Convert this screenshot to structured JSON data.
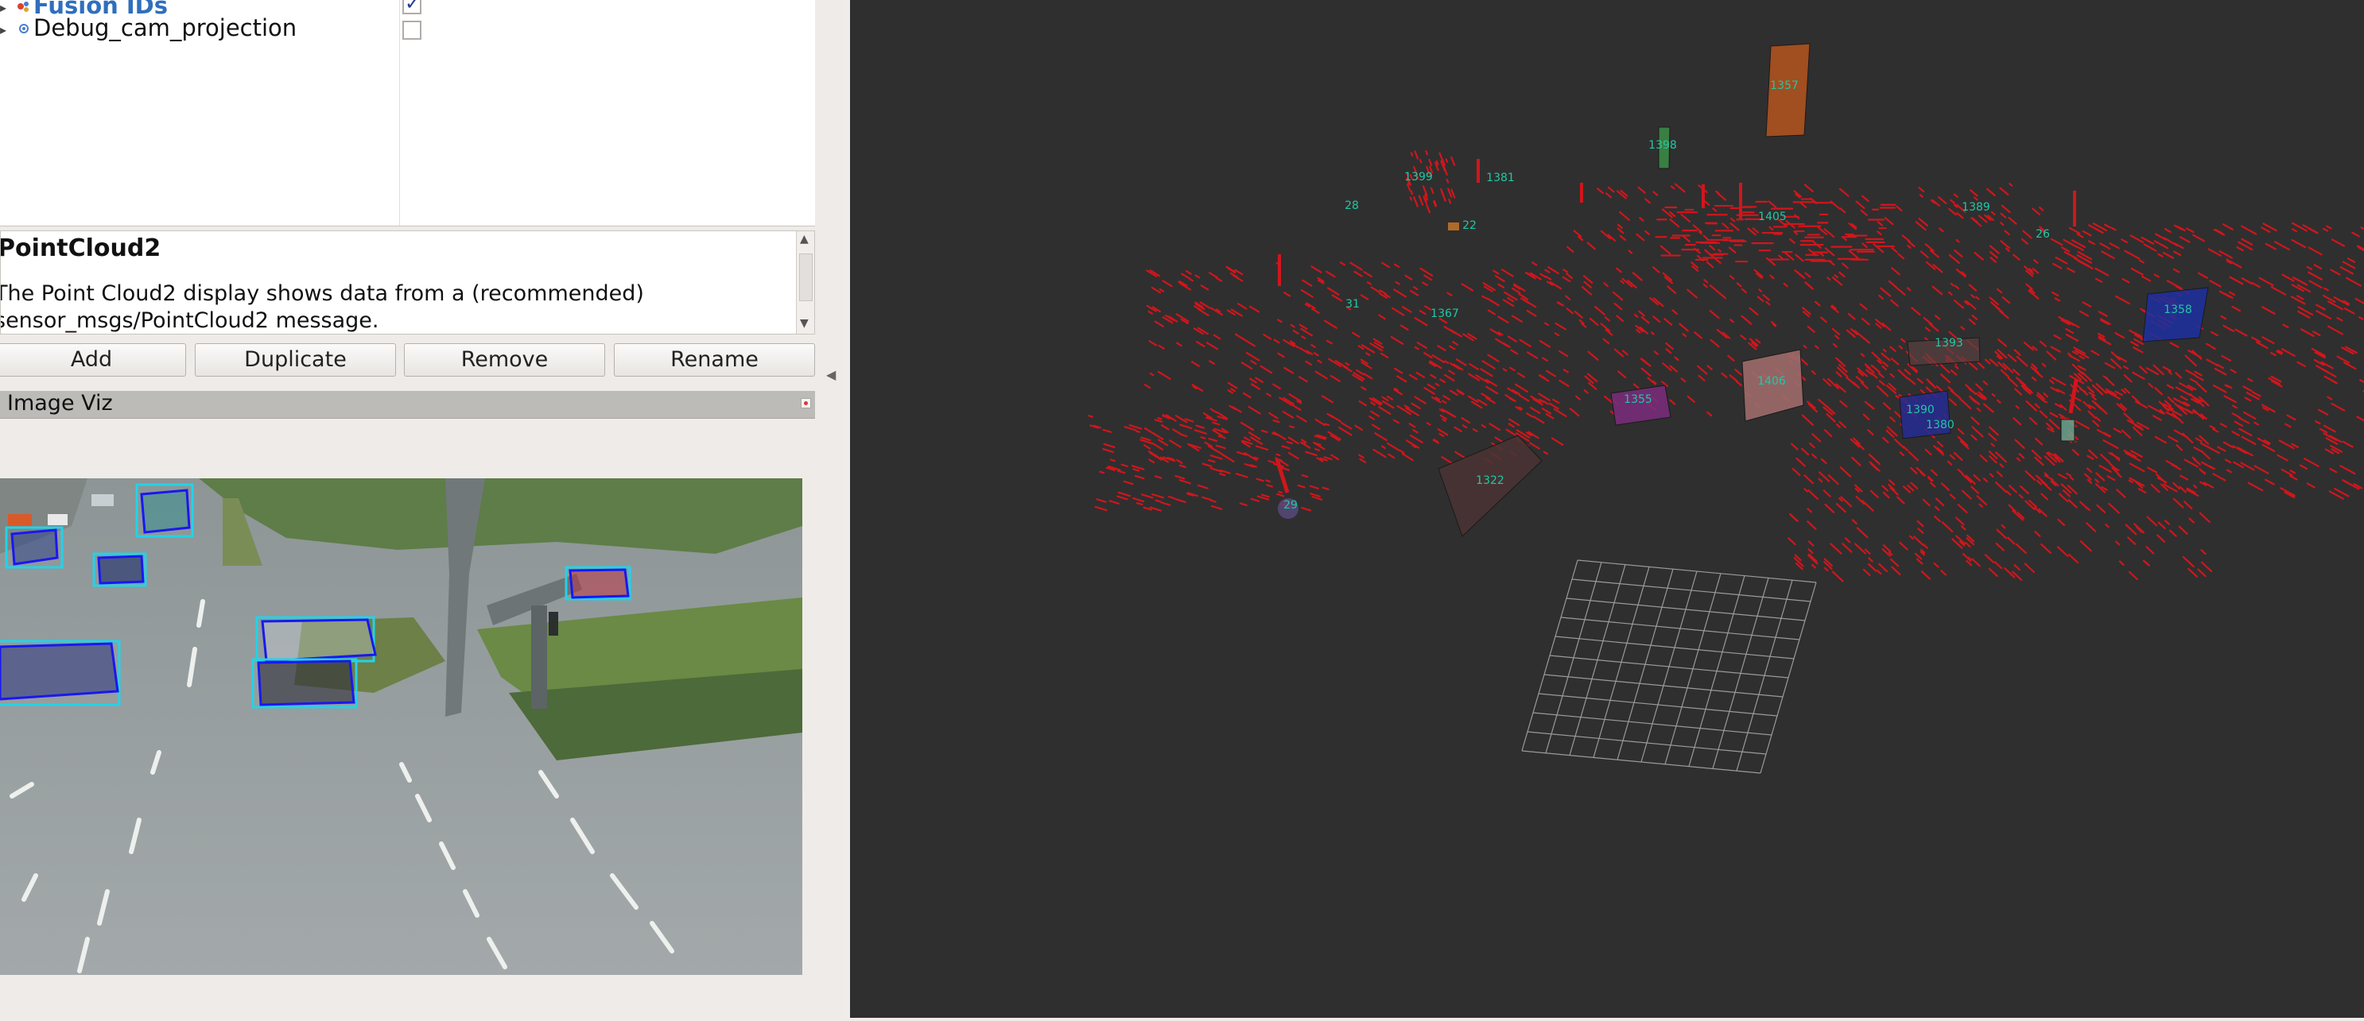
{
  "displays": {
    "items": [
      {
        "label": "Fusion IDs",
        "checked": true,
        "icon": "markers-icon",
        "selected": true
      },
      {
        "label": "Debug_cam_projection",
        "checked": false,
        "icon": "camera-icon",
        "selected": false
      }
    ]
  },
  "description": {
    "title": "PointCloud2",
    "text": "The Point Cloud2 display shows data from a (recommended) sensor_msgs/PointCloud2 message."
  },
  "buttons": {
    "add": "Add",
    "duplicate": "Duplicate",
    "remove": "Remove",
    "rename": "Rename"
  },
  "image_panel": {
    "title": "Image Viz"
  },
  "scene": {
    "track_ids": [
      "1357",
      "1398",
      "1399",
      "1381",
      "28",
      "22",
      "1405",
      "1389",
      "26",
      "31",
      "1367",
      "1358",
      "1393",
      "1406",
      "1355",
      "1390",
      "1380",
      "1322",
      "29"
    ],
    "colors": {
      "background": "#2f2f2f",
      "point_cloud": "#d0161c",
      "id_label": "#22c7a5",
      "grid": "#9a9a9a"
    }
  },
  "camera": {
    "detection_colors": {
      "box2d": "#22d3e8",
      "box3d": "#1818f0"
    }
  }
}
